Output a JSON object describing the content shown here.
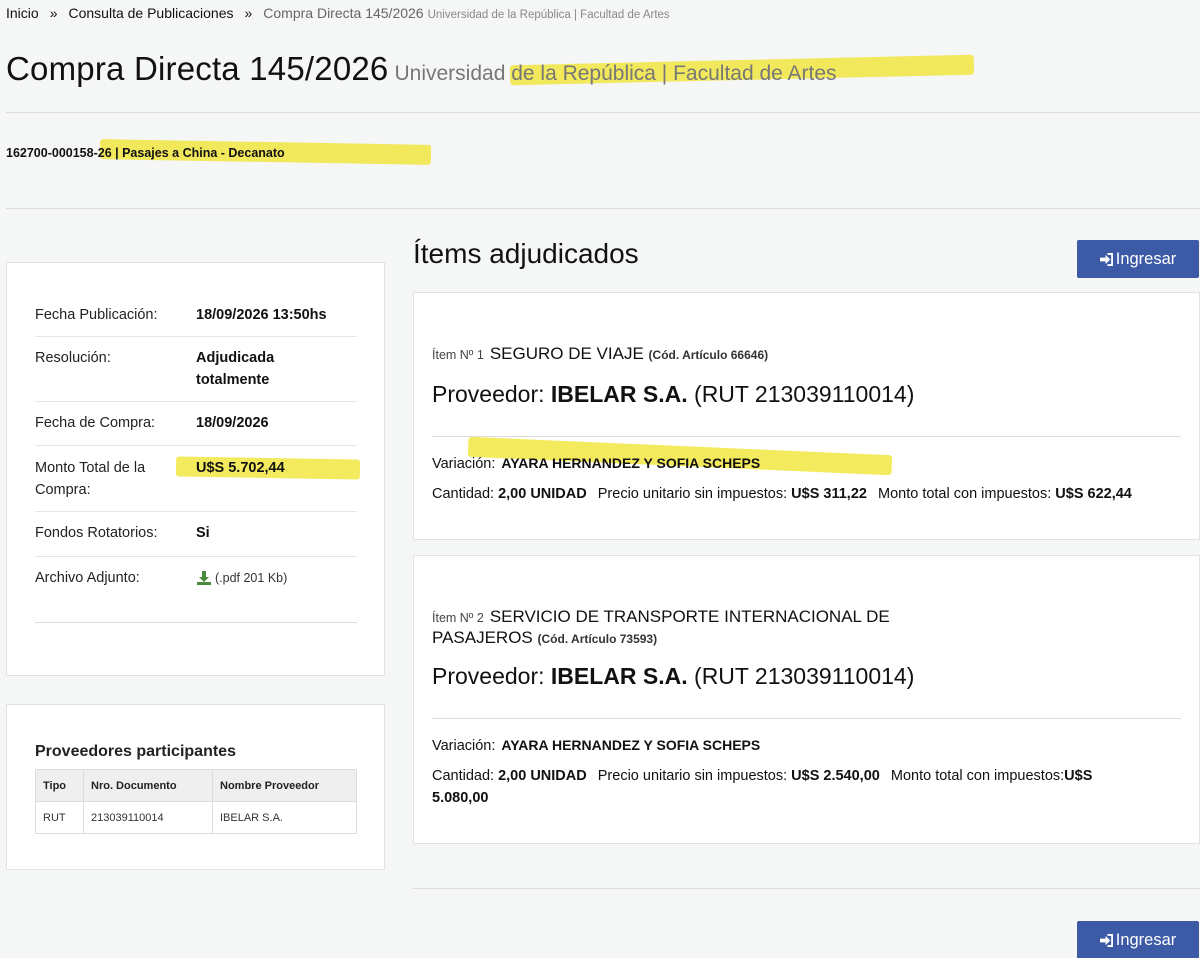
{
  "breadcrumb": {
    "home": "Inicio",
    "sep1": "»",
    "consulta": "Consulta de Publicaciones",
    "sep2": "»",
    "current": "Compra Directa 145/2026",
    "current_sub": "Universidad de la República | Facultad de Artes"
  },
  "title": {
    "main": "Compra Directa 145/2026",
    "subtitle": "Universidad de la República | Facultad de Artes"
  },
  "reference": "162700-000158-26 | Pasajes a China - Decanato",
  "info": {
    "rows": [
      {
        "label": "Fecha Publicación:",
        "value": "18/09/2026 13:50hs"
      },
      {
        "label": "Resolución:",
        "value": "Adjudicada totalmente"
      },
      {
        "label": "Fecha de Compra:",
        "value": "18/09/2026"
      },
      {
        "label": "Monto Total de la Compra:",
        "value": "U$S 5.702,44"
      },
      {
        "label": "Fondos Rotatorios:",
        "value": "Si"
      },
      {
        "label": "Archivo Adjunto:",
        "value": "(.pdf 201 Kb)"
      }
    ]
  },
  "providers": {
    "title": "Proveedores participantes",
    "headers": [
      "Tipo",
      "Nro. Documento",
      "Nombre Proveedor"
    ],
    "rows": [
      [
        "RUT",
        "213039110014",
        "IBELAR S.A."
      ]
    ]
  },
  "items_section": {
    "title": "Ítems adjudicados",
    "button_label": "Ingresar"
  },
  "items": [
    {
      "item_no": "Ítem Nº 1",
      "name": "SEGURO DE VIAJE",
      "code": "(Cód. Artículo 66646)",
      "prov_label": "Proveedor:",
      "prov_name": "IBELAR S.A.",
      "prov_rut": "(RUT 213039110014)",
      "var_label": "Variación:",
      "var_value": "AYARA HERNANDEZ Y SOFIA SCHEPS",
      "qty_label": "Cantidad:",
      "qty_value": "2,00 UNIDAD",
      "unit_label": "Precio unitario sin impuestos:",
      "unit_value": "U$S 311,22",
      "total_label": "Monto total con impuestos:",
      "total_value": "U$S 622,44"
    },
    {
      "item_no": "Ítem Nº 2",
      "name": "SERVICIO DE TRANSPORTE INTERNACIONAL DE PASAJEROS",
      "code": "(Cód. Artículo 73593)",
      "prov_label": "Proveedor:",
      "prov_name": "IBELAR S.A.",
      "prov_rut": "(RUT 213039110014)",
      "var_label": "Variación:",
      "var_value": "AYARA HERNANDEZ Y SOFIA SCHEPS",
      "qty_label": "Cantidad:",
      "qty_value": "2,00 UNIDAD",
      "unit_label": "Precio unitario sin impuestos:",
      "unit_value": "U$S 2.540,00",
      "total_label": "Monto total con impuestos:",
      "total_value": "U$S 5.080,00"
    }
  ],
  "colors": {
    "accent": "#3d5aa7",
    "highlight": "#f1e431",
    "download_icon": "#4a8a3c"
  }
}
